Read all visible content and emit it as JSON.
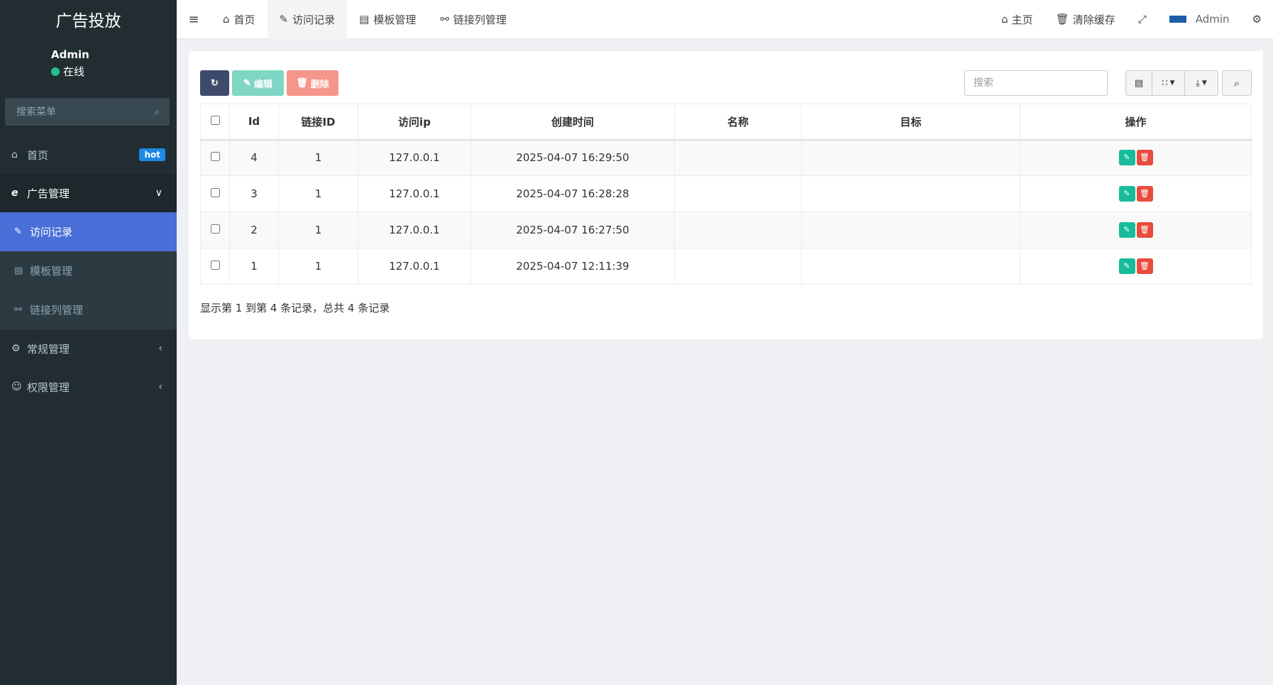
{
  "sidebar": {
    "brand": "广告投放",
    "user_name": "Admin",
    "user_status": "在线",
    "search_placeholder": "搜索菜单",
    "items": [
      {
        "label": "首页",
        "badge": "hot"
      },
      {
        "label": "广告管理"
      },
      {
        "label": "常规管理"
      },
      {
        "label": "权限管理"
      }
    ],
    "sub_items": [
      {
        "label": "访问记录"
      },
      {
        "label": "模板管理"
      },
      {
        "label": "链接列管理"
      }
    ]
  },
  "topbar": {
    "tabs": [
      {
        "label": "首页"
      },
      {
        "label": "访问记录"
      },
      {
        "label": "模板管理"
      },
      {
        "label": "链接列管理"
      }
    ],
    "home_link": "主页",
    "clear_cache": "清除缓存",
    "admin_name": "Admin"
  },
  "toolbar": {
    "edit_label": "编辑",
    "delete_label": "删除",
    "search_placeholder": "搜索"
  },
  "table": {
    "headers": [
      "Id",
      "链接ID",
      "访问ip",
      "创建时间",
      "名称",
      "目标",
      "操作"
    ],
    "rows": [
      {
        "id": "4",
        "link_id": "1",
        "ip": "127.0.0.1",
        "created": "2025-04-07 16:29:50",
        "name": "",
        "target": ""
      },
      {
        "id": "3",
        "link_id": "1",
        "ip": "127.0.0.1",
        "created": "2025-04-07 16:28:28",
        "name": "",
        "target": ""
      },
      {
        "id": "2",
        "link_id": "1",
        "ip": "127.0.0.1",
        "created": "2025-04-07 16:27:50",
        "name": "",
        "target": ""
      },
      {
        "id": "1",
        "link_id": "1",
        "ip": "127.0.0.1",
        "created": "2025-04-07 12:11:39",
        "name": "",
        "target": ""
      }
    ]
  },
  "pagination": {
    "info": "显示第 1 到第 4 条记录，总共 4 条记录"
  },
  "colors": {
    "sidebar_bg": "#222d32",
    "active_item": "#4a6fd8",
    "refresh_button": "#3e4a6b",
    "edit_button": "#7fd6c2",
    "delete_button": "#f6958a",
    "op_edit": "#18bc9c",
    "op_delete": "#e74c3c",
    "hot_badge": "#1e88e5",
    "online_dot": "#25c08a"
  }
}
